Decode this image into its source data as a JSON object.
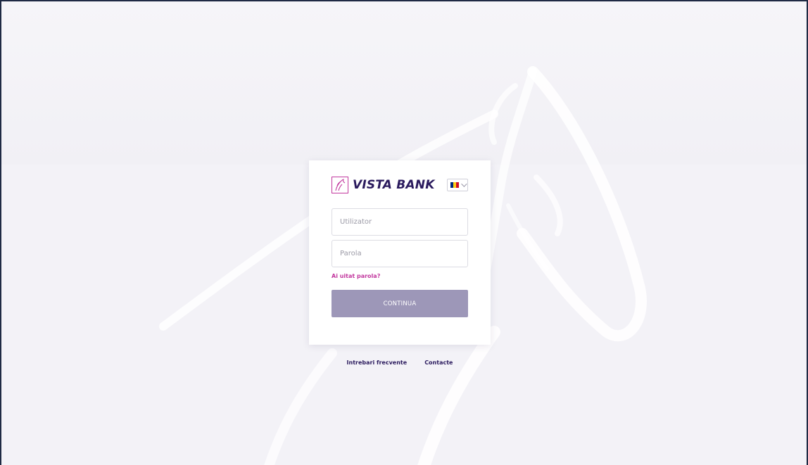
{
  "brand": {
    "name": "VISTA BANK",
    "text_color": "#2b1b5e",
    "accent_color": "#c2379e",
    "logo_icon": "horse-head-icon"
  },
  "language_selector": {
    "selected": "Romanian",
    "flag_icon": "romania-flag-icon",
    "flag_colors": [
      "#002b7f",
      "#fcd116",
      "#ce1126"
    ]
  },
  "login_form": {
    "username_placeholder": "Utilizator",
    "password_placeholder": "Parola",
    "forgot_password_label": "Ai uitat parola?",
    "submit_label": "CONTINUA",
    "submit_color": "#9d97b8"
  },
  "footer": {
    "links": [
      {
        "label": "Intrebari frecvente"
      },
      {
        "label": "Contacte"
      }
    ]
  },
  "background": {
    "color": "#f3f2f7",
    "watermark_icon": "horse-watermark-icon"
  }
}
